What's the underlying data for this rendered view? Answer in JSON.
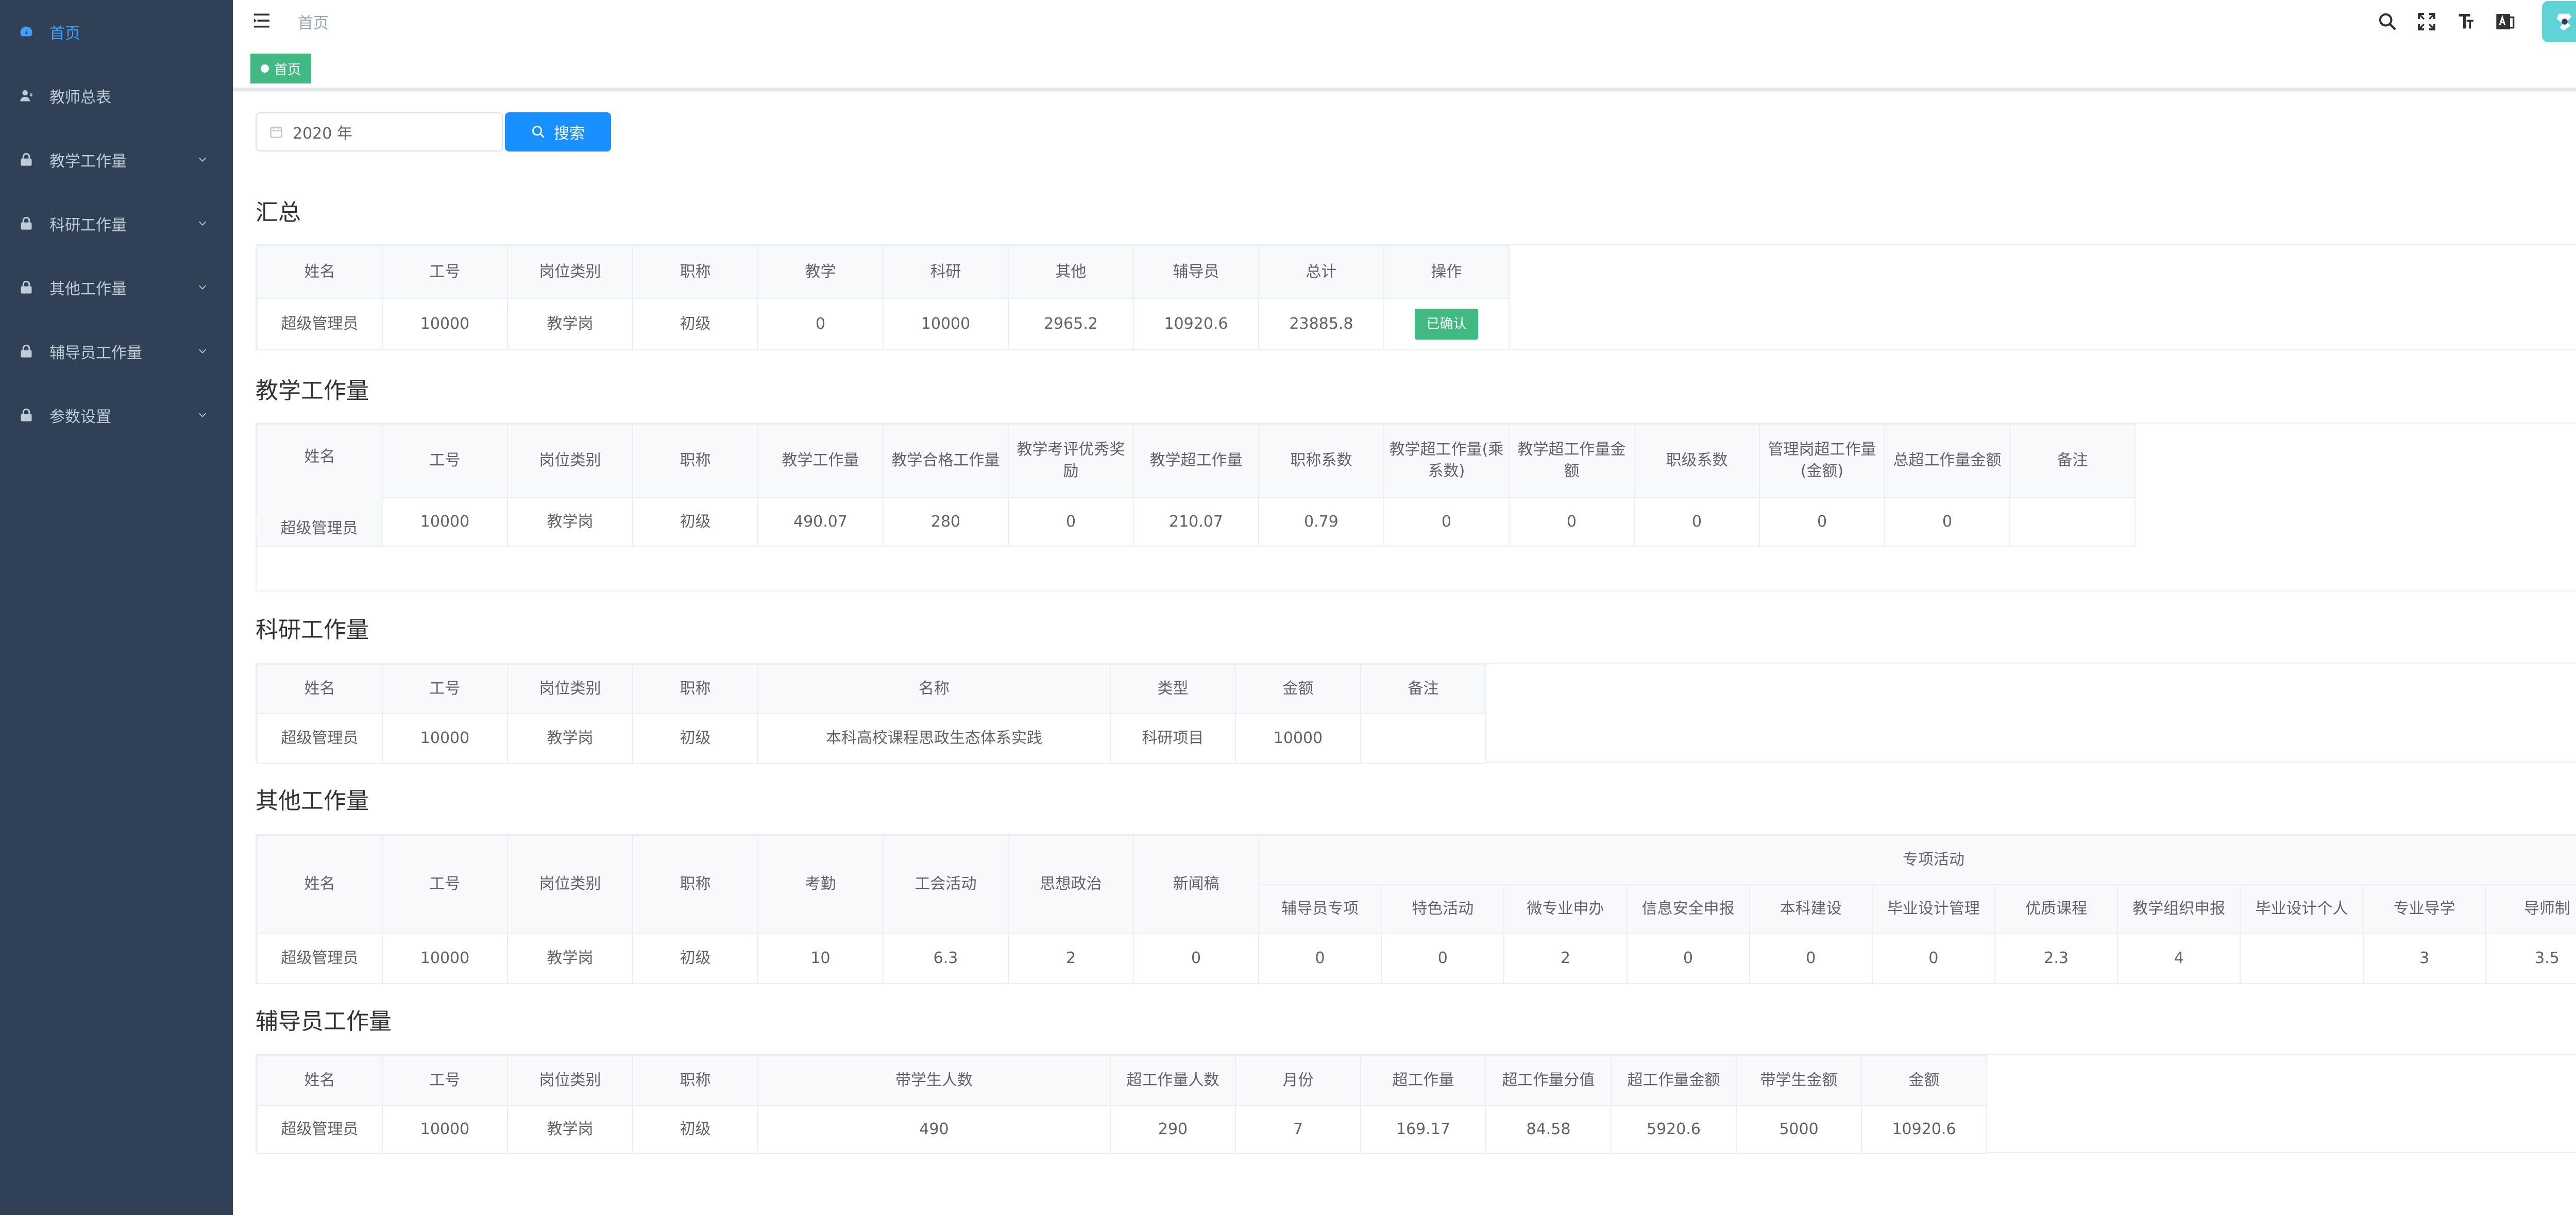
{
  "sidebar": {
    "items": [
      {
        "label": "首页",
        "icon": "dashboard-icon",
        "active": true
      },
      {
        "label": "教师总表",
        "icon": "user-icon"
      },
      {
        "label": "教学工作量",
        "icon": "lock-icon",
        "expandable": true
      },
      {
        "label": "科研工作量",
        "icon": "lock-icon",
        "expandable": true
      },
      {
        "label": "其他工作量",
        "icon": "lock-icon",
        "expandable": true
      },
      {
        "label": "辅导员工作量",
        "icon": "lock-icon",
        "expandable": true
      },
      {
        "label": "参数设置",
        "icon": "lock-icon",
        "expandable": true
      }
    ]
  },
  "navbar": {
    "breadcrumb": "首页",
    "icons": [
      "search-icon",
      "fullscreen-icon",
      "font-size-icon",
      "language-icon"
    ]
  },
  "tags": {
    "active": "首页"
  },
  "search": {
    "year_value": "2020 年",
    "button_label": "搜索"
  },
  "summary": {
    "title": "汇总",
    "headers": [
      "姓名",
      "工号",
      "岗位类别",
      "职称",
      "教学",
      "科研",
      "其他",
      "辅导员",
      "总计",
      "操作"
    ],
    "row": [
      "超级管理员",
      "10000",
      "教学岗",
      "初级",
      "0",
      "10000",
      "2965.2",
      "10920.6",
      "23885.8"
    ],
    "action_label": "已确认"
  },
  "teaching": {
    "title": "教学工作量",
    "headers": [
      "姓名",
      "工号",
      "岗位类别",
      "职称",
      "教学工作量",
      "教学合格工作量",
      "教学考评优秀奖励",
      "教学超工作量",
      "职称系数",
      "教学超工作量(乘系数)",
      "教学超工作量金额",
      "职级系数",
      "管理岗超工作量(金额)",
      "总超工作量金额",
      "备注"
    ],
    "row": [
      "超级管理员",
      "10000",
      "教学岗",
      "初级",
      "490.07",
      "280",
      "0",
      "210.07",
      "0.79",
      "0",
      "0",
      "0",
      "0",
      "0",
      ""
    ]
  },
  "research": {
    "title": "科研工作量",
    "headers": [
      "姓名",
      "工号",
      "岗位类别",
      "职称",
      "名称",
      "类型",
      "金额",
      "备注"
    ],
    "row": [
      "超级管理员",
      "10000",
      "教学岗",
      "初级",
      "本科高校课程思政生态体系实践",
      "科研项目",
      "10000",
      ""
    ]
  },
  "other": {
    "title": "其他工作量",
    "headers": [
      "姓名",
      "工号",
      "岗位类别",
      "职称",
      "考勤",
      "工会活动",
      "思想政治",
      "新闻稿"
    ],
    "group_header": "专项活动",
    "sub_headers": [
      "辅导员专项",
      "特色活动",
      "微专业申办",
      "信息安全申报",
      "本科建设",
      "毕业设计管理",
      "优质课程",
      "教学组织申报",
      "毕业设计个人",
      "专业导学",
      "导师制"
    ],
    "row": [
      "超级管理员",
      "10000",
      "教学岗",
      "初级",
      "10",
      "6.3",
      "2",
      "0",
      "0",
      "0",
      "2",
      "0",
      "0",
      "0",
      "2.3",
      "4",
      "",
      "3",
      "3.5"
    ]
  },
  "counselor": {
    "title": "辅导员工作量",
    "headers": [
      "姓名",
      "工号",
      "岗位类别",
      "职称",
      "带学生人数",
      "超工作量人数",
      "月份",
      "超工作量",
      "超工作量分值",
      "超工作量金额",
      "带学生金额",
      "金额"
    ],
    "row": [
      "超级管理员",
      "10000",
      "教学岗",
      "初级",
      "490",
      "290",
      "7",
      "169.17",
      "84.58",
      "5920.6",
      "5000",
      "10920.6"
    ]
  },
  "colors": {
    "sidebar_bg": "#304156",
    "sidebar_text": "#bfcbd9",
    "active": "#409eff",
    "primary": "#1890ff",
    "success": "#42b983"
  }
}
